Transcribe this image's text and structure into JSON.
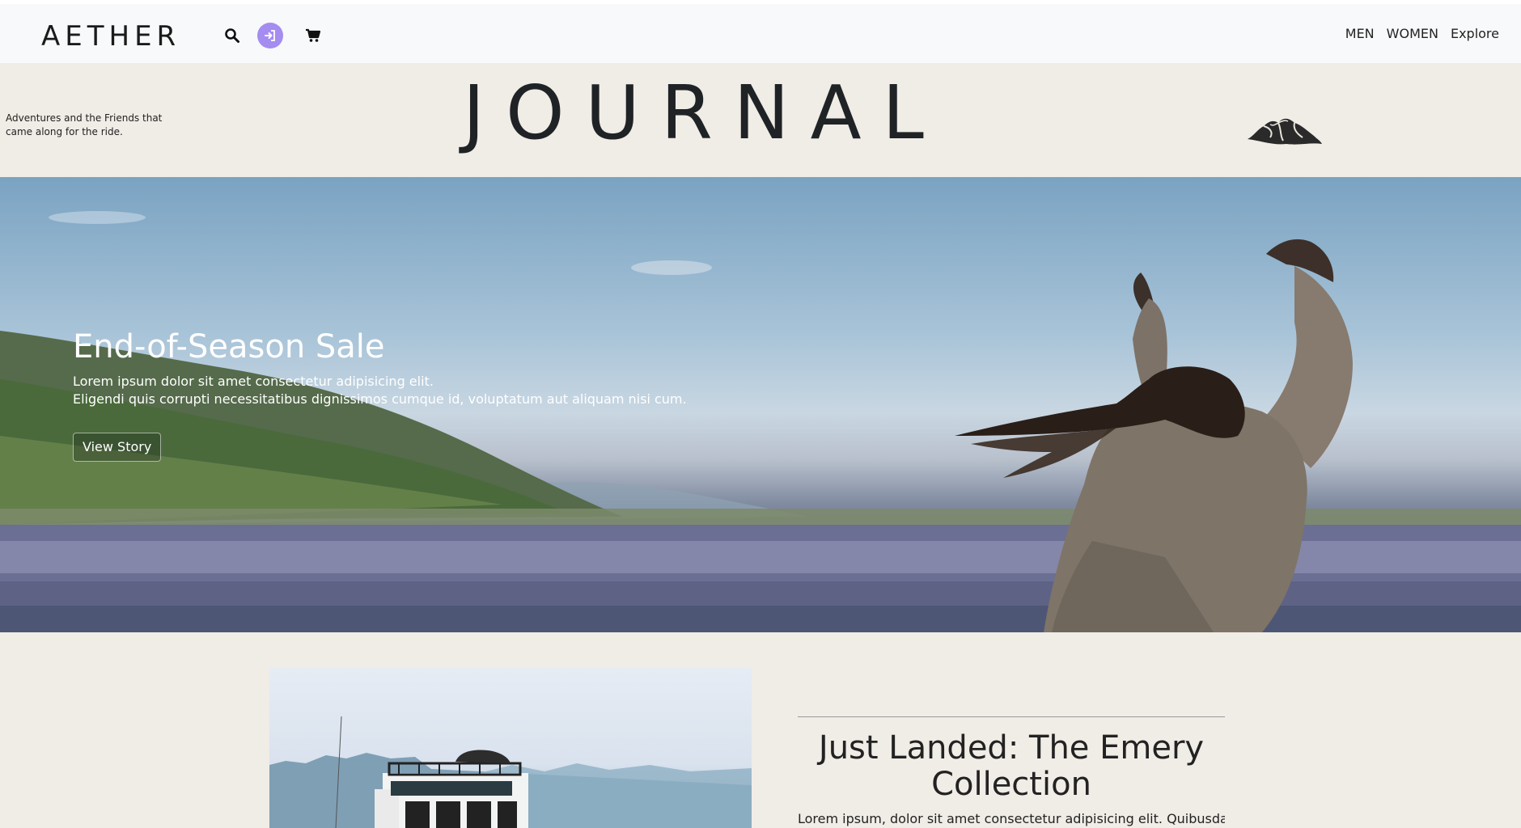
{
  "navbar": {
    "brand": "AETHER",
    "icons": {
      "search": "search-icon",
      "login": "sign-in-icon",
      "cart": "shopping-cart-icon"
    },
    "links": [
      "MEN",
      "WOMEN",
      "Explore"
    ]
  },
  "journal": {
    "tagline": "Adventures and the Friends that came along for the ride.",
    "title": "JOURNAL",
    "logo": "mountain-logo"
  },
  "hero": {
    "title": "End-of-Season Sale",
    "line1": "Lorem ipsum dolor sit amet consectetur adipisicing elit.",
    "line2": "Eligendi quis corrupti necessitatibus dignissimos cumque id, voluptatum aut aliquam nisi cum.",
    "button": "View Story"
  },
  "feature": {
    "title": "Just Landed: The Emery Collection",
    "body": "Lorem ipsum, dolor sit amet consectetur adipisicing elit. Quibusdam"
  },
  "colors": {
    "accent": "#a58cf0",
    "page_bg": "#f0ece6",
    "navbar_bg": "#f8f9fa"
  }
}
